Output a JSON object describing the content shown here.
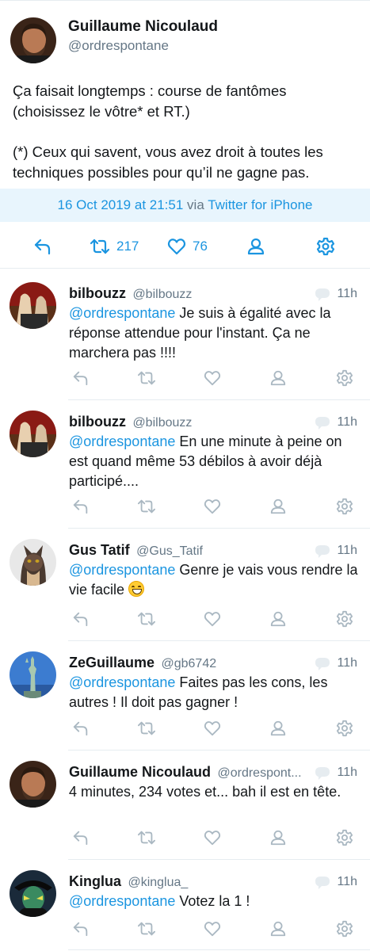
{
  "main_tweet": {
    "name": "Guillaume Nicoulaud",
    "handle": "@ordrespontane",
    "text_line1": "Ça faisait longtemps : course de fantômes (choisissez le vôtre* et RT.)",
    "text_line2": "(*) Ceux qui savent, vous avez droit à toutes les techniques possibles pour qu’il ne gagne pas.",
    "date": "16 Oct 2019 at 21:51",
    "via": "via",
    "source": "Twitter for iPhone",
    "retweets": "217",
    "likes": "76"
  },
  "colors": {
    "accent": "#1b95e0",
    "muted": "#657786",
    "icon_grey": "#aab8c2",
    "meta_bg": "#e8f5fd",
    "divider": "#e6ecf0"
  },
  "icons": [
    "reply-icon",
    "retweet-icon",
    "heart-icon",
    "user-icon",
    "gear-icon",
    "conversation-bubble-icon"
  ],
  "replies": [
    {
      "name": "bilbouzz",
      "handle": "@bilbouzz",
      "time": "11h",
      "mention": "@ordrespontane",
      "text": " Je suis à égalité avec la réponse attendue pour l'instant. Ça ne marchera pas  !!!!"
    },
    {
      "name": "bilbouzz",
      "handle": "@bilbouzz",
      "time": "11h",
      "mention": "@ordrespontane",
      "text": " En une minute à peine on est quand même 53 débilos à avoir déjà participé...."
    },
    {
      "name": "Gus Tatif",
      "handle": "@Gus_Tatif",
      "time": "11h",
      "mention": "@ordrespontane",
      "text": " Genre je vais vous rendre la vie facile "
    },
    {
      "name": "ZeGuillaume",
      "handle": "@gb6742",
      "time": "11h",
      "mention": "@ordrespontane",
      "text": " Faites pas les cons, les autres ! Il doit pas gagner !"
    },
    {
      "name": "Guillaume Nicoulaud",
      "handle": "@ordrespont...",
      "time": "11h",
      "mention": "",
      "text": "4 minutes, 234 votes et... bah il est en tête."
    },
    {
      "name": "Kinglua",
      "handle": "@kinglua_",
      "time": "11h",
      "mention": "@ordrespontane",
      "text": " Votez la 1 !"
    }
  ]
}
